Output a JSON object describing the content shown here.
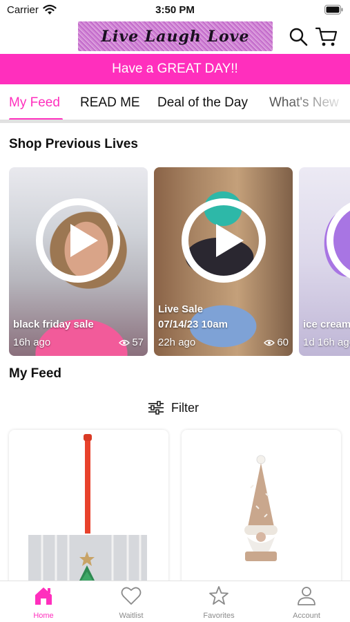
{
  "status": {
    "carrier": "Carrier",
    "time": "3:50 PM"
  },
  "header": {
    "logo_text": "Live Laugh Love"
  },
  "banner": {
    "text": "Have a GREAT DAY!!"
  },
  "tabs": [
    {
      "label": "My Feed",
      "active": true
    },
    {
      "label": "READ ME"
    },
    {
      "label": "Deal of the Day"
    },
    {
      "label": "What's New"
    }
  ],
  "sections": {
    "lives_title": "Shop Previous Lives",
    "feed_title": "My Feed"
  },
  "lives": [
    {
      "title_lines": [
        "black friday sale"
      ],
      "ago": "16h ago",
      "views": "57"
    },
    {
      "title_lines": [
        "Live Sale",
        "07/14/23 10am"
      ],
      "ago": "22h ago",
      "views": "60"
    },
    {
      "title_lines": [
        "ice cream"
      ],
      "ago": "1d 16h ago",
      "views": ""
    }
  ],
  "filter": {
    "label": "Filter"
  },
  "bottom_nav": [
    {
      "label": "Home",
      "icon": "home-icon",
      "active": true
    },
    {
      "label": "Waitlist",
      "icon": "heart-icon"
    },
    {
      "label": "Favorites",
      "icon": "star-icon"
    },
    {
      "label": "Account",
      "icon": "person-icon"
    }
  ],
  "colors": {
    "accent": "#ff2fbd",
    "banner_text": "#ffffff",
    "nav_inactive": "#8a8a8a"
  }
}
